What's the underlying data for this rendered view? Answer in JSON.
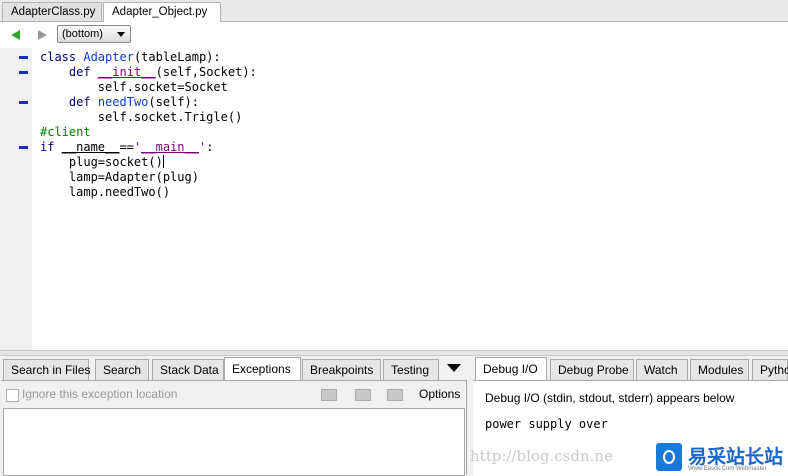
{
  "editor_tabs": [
    {
      "label": "AdapterClass.py",
      "active": false
    },
    {
      "label": "Adapter_Object.py",
      "active": true
    }
  ],
  "nav": {
    "scope_value": "(bottom)"
  },
  "code": {
    "lines": [
      "class Adapter(tableLamp):",
      "    def __init__(self,Socket):",
      "        self.socket=Socket",
      "    def needTwo(self):",
      "        self.socket.Trigle()",
      "#client",
      "if __name__=='__main__':",
      "    plug=socket()",
      "    lamp=Adapter(plug)",
      "    lamp.needTwo()"
    ]
  },
  "left_pane": {
    "tabs": [
      "Search in Files",
      "Search",
      "Stack Data",
      "Exceptions",
      "Breakpoints",
      "Testing"
    ],
    "active_tab": "Exceptions",
    "ignore_label": "Ignore this exception location",
    "options_label": "Options"
  },
  "right_pane": {
    "tabs": [
      "Debug I/O",
      "Debug Probe",
      "Watch",
      "Modules",
      "Pytho"
    ],
    "active_tab": "Debug I/O",
    "message": "Debug I/O (stdin, stdout, stderr) appears below",
    "output": "power supply over"
  },
  "watermark": {
    "url": "http://blog.csdn.ne",
    "logo_text": "易采站长站",
    "logo_sub": "Www.Easck.Com Webmaster"
  },
  "colors": {
    "keyword": "#00007f",
    "function_name": "#1040d0",
    "string": "#7f007f",
    "comment": "#007f00",
    "fold_marker": "#1a2fb5",
    "nav_back_green": "#2aa82a"
  }
}
